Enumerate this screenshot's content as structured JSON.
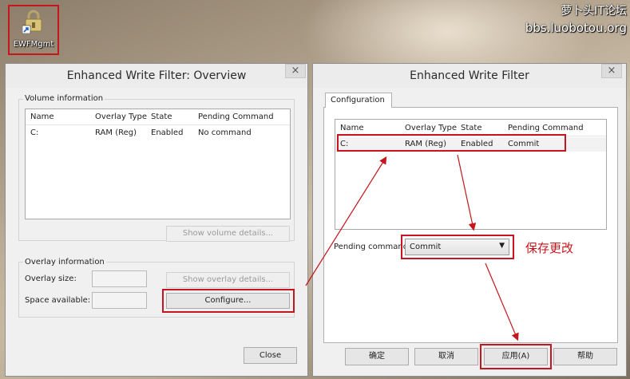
{
  "watermark": {
    "line1": "萝卜头IT论坛",
    "line2": "bbs.luobotou.org"
  },
  "desktop_icon": {
    "label": "EWFMgmt"
  },
  "overview_window": {
    "title": "Enhanced Write Filter: Overview",
    "close_glyph": "×",
    "volume_group_label": "Volume information",
    "columns": [
      "Name",
      "Overlay Type",
      "State",
      "Pending Command"
    ],
    "rows": [
      {
        "name": "C:",
        "overlay_type": "RAM (Reg)",
        "state": "Enabled",
        "pending": "No command"
      }
    ],
    "show_volume_details": "Show volume details...",
    "overlay_group_label": "Overlay information",
    "overlay_size_label": "Overlay size:",
    "space_available_label": "Space available:",
    "show_overlay_details": "Show overlay details...",
    "configure_button": "Configure...",
    "close_button": "Close"
  },
  "filter_window": {
    "title": "Enhanced Write Filter",
    "close_glyph": "×",
    "tab_label": "Configuration",
    "columns": [
      "Name",
      "Overlay Type",
      "State",
      "Pending Command"
    ],
    "rows": [
      {
        "name": "C:",
        "overlay_type": "RAM (Reg)",
        "state": "Enabled",
        "pending": "Commit"
      }
    ],
    "pending_command_label": "Pending command:",
    "pending_command_value": "Commit",
    "annotation": "保存更改",
    "buttons": {
      "ok": "确定",
      "cancel": "取消",
      "apply": "应用(A)",
      "help": "帮助"
    }
  },
  "colors": {
    "highlight": "#c4161c",
    "window_bg": "#f0f0f0"
  }
}
